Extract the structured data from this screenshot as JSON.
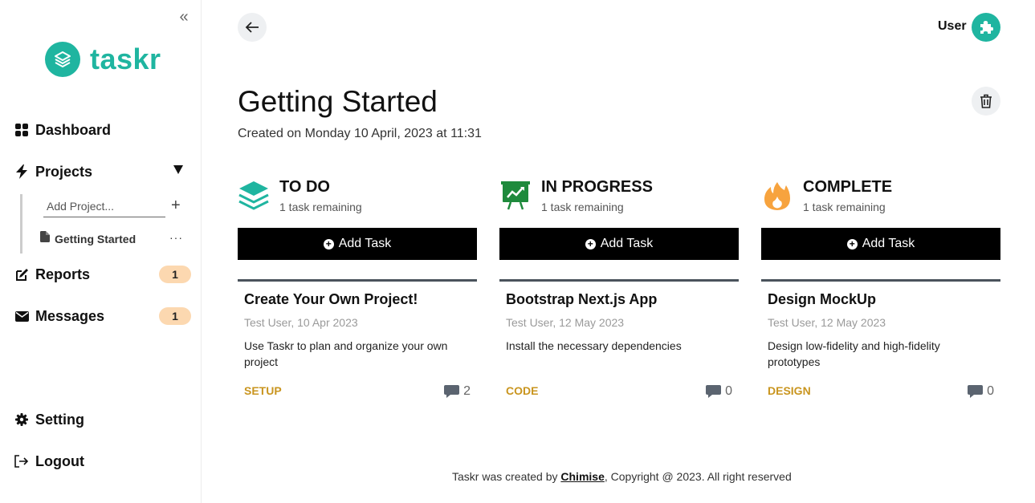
{
  "app": {
    "name": "taskr",
    "brand_color": "#1fb5a0"
  },
  "sidebar": {
    "nav": {
      "dashboard": "Dashboard",
      "projects": "Projects",
      "reports": "Reports",
      "reports_badge": "1",
      "messages": "Messages",
      "messages_badge": "1",
      "setting": "Setting",
      "logout": "Logout"
    },
    "add_project_placeholder": "Add Project...",
    "project_item": "Getting Started"
  },
  "header": {
    "user_label": "User"
  },
  "project": {
    "title": "Getting Started",
    "created": "Created on Monday 10 April, 2023 at 11:31"
  },
  "columns": [
    {
      "title": "TO DO",
      "remaining": "1 task remaining",
      "add_label": "Add Task",
      "icon": "layers-icon",
      "card": {
        "title": "Create Your Own Project!",
        "meta": "Test User, 10 Apr 2023",
        "desc": "Use Taskr to plan and organize your own project",
        "tag": "SETUP",
        "comments": "2"
      }
    },
    {
      "title": "IN PROGRESS",
      "remaining": "1 task remaining",
      "add_label": "Add Task",
      "icon": "presentation-chart-icon",
      "card": {
        "title": "Bootstrap Next.js App",
        "meta": "Test User, 12 May 2023",
        "desc": "Install the necessary dependencies",
        "tag": "CODE",
        "comments": "0"
      }
    },
    {
      "title": "COMPLETE",
      "remaining": "1 task remaining",
      "add_label": "Add Task",
      "icon": "fire-icon",
      "card": {
        "title": "Design MockUp",
        "meta": "Test User, 12 May 2023",
        "desc": "Design low-fidelity and high-fidelity prototypes",
        "tag": "DESIGN",
        "comments": "0"
      }
    }
  ],
  "footer": {
    "prefix": "Taskr was created by ",
    "author": "Chimise",
    "suffix": ", Copyright @ 2023. All right reserved"
  },
  "colors": {
    "tag": "#c9951f",
    "badge": "#fcd8b0",
    "card_border": "#4a535c"
  }
}
